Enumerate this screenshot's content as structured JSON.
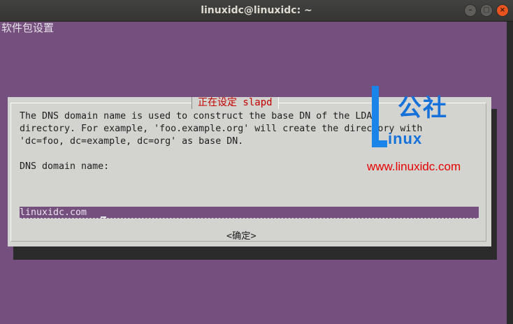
{
  "window": {
    "title": "linuxidc@linuxidc: ~",
    "controls": {
      "close": "×",
      "minimize": "–",
      "maximize": "□"
    }
  },
  "terminal": {
    "background_title": "软件包设置"
  },
  "dialog": {
    "title": "正在设定 slapd",
    "description": "The DNS domain name is used to construct the base DN of the LDAP\ndirectory. For example, 'foo.example.org' will create the directory with\n'dc=foo, dc=example, dc=org' as base DN.",
    "field_label": "DNS domain name:",
    "field_value": "linuxidc.com",
    "ok_button": "<确定>"
  },
  "watermark": {
    "logo_cn": "公社",
    "logo_en": "inux",
    "url": "www.linuxidc.com"
  },
  "colors": {
    "terminal_bg": "#754f7d",
    "dialog_bg": "#d3d3cf",
    "dialog_title": "#c40000",
    "accent_orange": "#e95420",
    "watermark_blue": "#1672d8",
    "watermark_red": "#e60000"
  }
}
